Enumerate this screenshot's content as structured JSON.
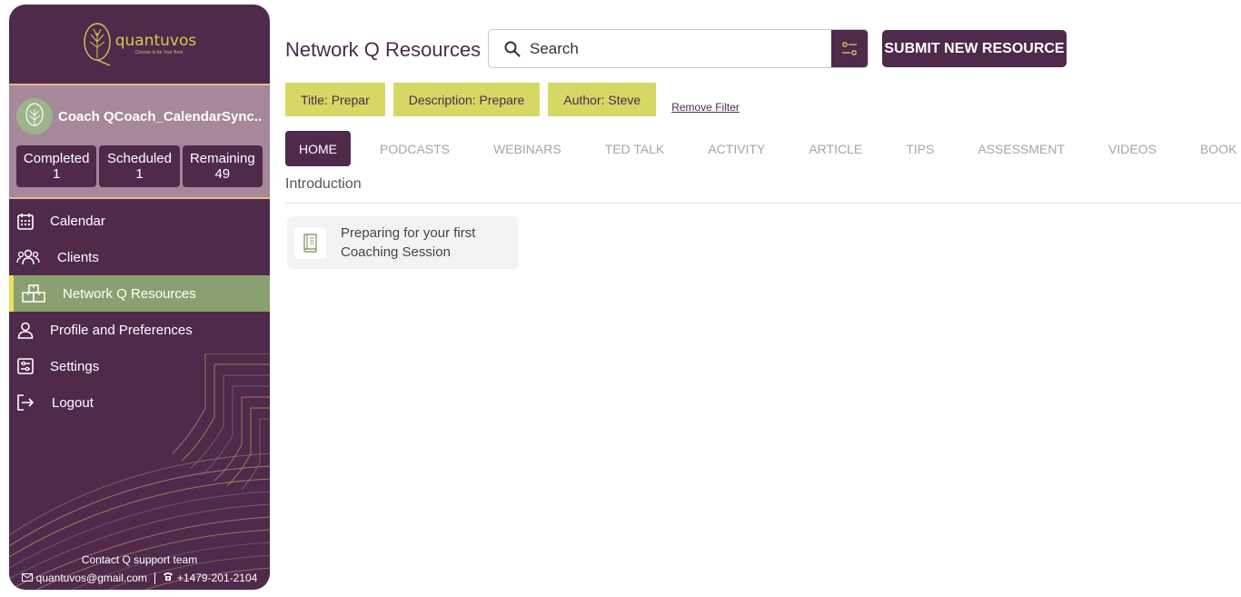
{
  "brand": {
    "name": "quantuvos",
    "tagline": "Choose to be Your Best"
  },
  "profile": {
    "name": "Coach QCoach_CalendarSync.....",
    "stats": [
      {
        "label": "Completed",
        "value": "1"
      },
      {
        "label": "Scheduled",
        "value": "1"
      },
      {
        "label": "Remaining",
        "value": "49"
      }
    ]
  },
  "nav": [
    {
      "label": "Calendar",
      "icon": "calendar-icon"
    },
    {
      "label": "Clients",
      "icon": "clients-icon"
    },
    {
      "label": "Network Q Resources",
      "icon": "resources-icon",
      "active": true
    },
    {
      "label": "Profile and Preferences",
      "icon": "user-icon"
    },
    {
      "label": "Settings",
      "icon": "settings-icon"
    },
    {
      "label": "Logout",
      "icon": "logout-icon"
    }
  ],
  "footer": {
    "support": "Contact Q support team",
    "email": "quantuvos@gmail.com",
    "phone": "+1479-201-2104"
  },
  "header": {
    "title": "Network Q Resources",
    "search_placeholder": "Search",
    "submit_label": "SUBMIT NEW RESOURCE"
  },
  "filters": [
    "Title: Prepar",
    "Description: Prepare",
    "Author: Steve"
  ],
  "remove_filter_label": "Remove Filter",
  "tabs": [
    "HOME",
    "PODCASTS",
    "WEBINARS",
    "TED TALK",
    "ACTIVITY",
    "ARTICLE",
    "TIPS",
    "ASSESSMENT",
    "VIDEOS",
    "BOOK"
  ],
  "active_tab": "HOME",
  "section": {
    "label": "Introduction"
  },
  "resources": [
    {
      "title": "Preparing for your first Coaching Session",
      "icon": "book-icon"
    }
  ],
  "colors": {
    "primary": "#4f2a4b",
    "profile_bg": "#a5889a",
    "active_nav": "#8aa070",
    "chip": "#d6d864",
    "accent_line": "#e8b98a",
    "logo": "#d8c64f"
  }
}
